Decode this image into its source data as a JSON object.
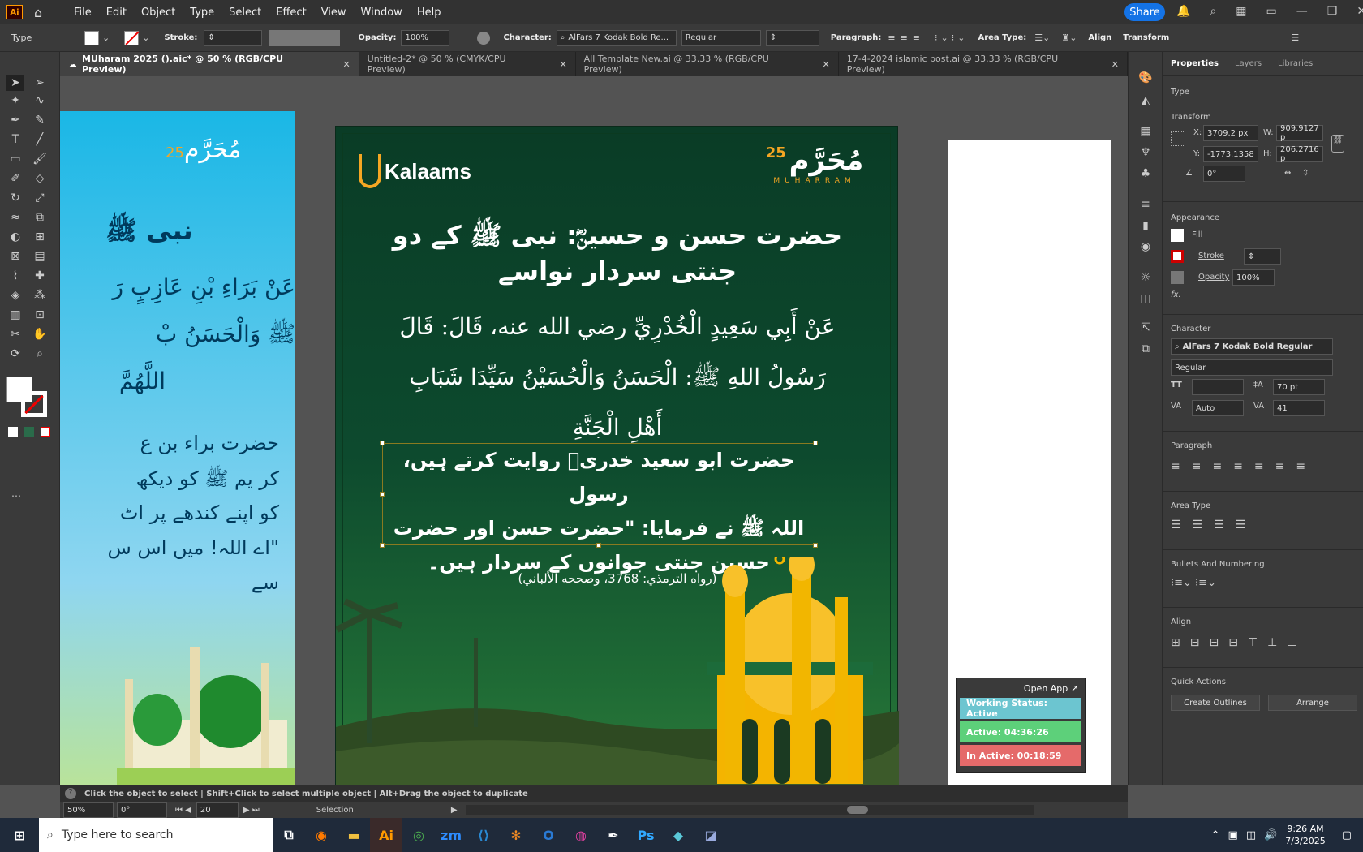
{
  "app": {
    "logo": "Ai",
    "menus": [
      "File",
      "Edit",
      "Object",
      "Type",
      "Select",
      "Effect",
      "View",
      "Window",
      "Help"
    ],
    "share": "Share"
  },
  "control": {
    "type_label": "Type",
    "stroke_label": "Stroke:",
    "opacity_label": "Opacity:",
    "opacity_value": "100%",
    "character_label": "Character:",
    "font_name": "AlFars 7 Kodak Bold Re...",
    "font_style": "Regular",
    "paragraph_label": "Paragraph:",
    "area_type_label": "Area Type:",
    "align_label": "Align",
    "transform_label": "Transform"
  },
  "tabs": [
    {
      "label": "MUharam 2025 ().aic* @ 50 % (RGB/CPU Preview)"
    },
    {
      "label": "Untitled-2* @ 50 % (CMYK/CPU Preview)"
    },
    {
      "label": "All Template New.ai @ 33.33 % (RGB/CPU Preview)"
    },
    {
      "label": "17-4-2024 islamic post.ai @ 33.33 % (RGB/CPU Preview)"
    }
  ],
  "artboard": {
    "brand": "Kalaams",
    "muharram_ar": "مُحَرَّم",
    "muharram_en": "MUHARRAM",
    "muharram_num": "25",
    "title_line1": "حضرت حسن و حسینؓ: نبی ﷺ کے دو",
    "title_line2": "جنتی سردار نواسے",
    "arabic_line1": "عَنْ أَبِي سَعِيدٍ الْخُدْرِيِّ رضي الله عنه، قَالَ: قَالَ",
    "arabic_line2": "رَسُولُ اللهِ ﷺ: الْحَسَنُ وَالْحُسَيْنُ سَيِّدَا شَبَابِ",
    "arabic_line3": "أَهْلِ الْجَنَّةِ",
    "urdu_line1": "حضرت ابو سعید خدریؓ روایت کرتے ہیں، رسول",
    "urdu_line2": "اللہ ﷺ نے فرمایا: \"حضرت حسن اور حضرت",
    "urdu_line3": "حسین جنتی جوانوں کے سردار ہیں۔",
    "reference": "(رواه الترمذي: 3768، وصححه الألباني)"
  },
  "left_artboard": {
    "line1": "نبی ﷺ",
    "line2": "عَنْ بَرَاءِ بْنِ عَازِبٍ رَ",
    "line3": "ﷺ وَالْحَسَنُ بْ",
    "line4": "اللَّهُمَّ",
    "u1": "حضرت براء بن ع",
    "u2": "کر یم ﷺ کو دیکھ",
    "u3": "کو اپنے کندھے پر اٹ",
    "u4": "\"اے اللہ! میں اس س",
    "u5": "سے"
  },
  "panel": {
    "tabs": [
      "Properties",
      "Layers",
      "Libraries"
    ],
    "type": "Type",
    "transform": "Transform",
    "x": "3709.2 px",
    "y": "-1773.1358",
    "w": "909.9127 p",
    "h": "206.2716 p",
    "angle": "0°",
    "appearance": "Appearance",
    "fill": "Fill",
    "stroke": "Stroke",
    "opacity": "Opacity",
    "opacity_value": "100%",
    "fx": "fx.",
    "character": "Character",
    "font": "AlFars 7 Kodak Bold Regular",
    "style": "Regular",
    "size": "",
    "leading": "70 pt",
    "kerning": "Auto",
    "tracking": "41",
    "paragraph": "Paragraph",
    "area_type": "Area Type",
    "bullets": "Bullets And Numbering",
    "align": "Align",
    "quick_actions": "Quick Actions",
    "create_outlines": "Create Outlines",
    "arrange": "Arrange"
  },
  "widget": {
    "open_app": "Open App ↗",
    "working": "Working Status: Active",
    "active": "Active: 04:36:26",
    "inactive": "In Active: 00:18:59",
    "colors": {
      "working": "#6cc5d0",
      "active": "#5dd07a",
      "inactive": "#e56a6a"
    }
  },
  "status": {
    "hint": "Click the object to select  |  Shift+Click to select multiple object  |  Alt+Drag the object to duplicate",
    "zoom": "50%",
    "rotate": "0°",
    "artboard": "20",
    "tool": "Selection"
  },
  "taskbar": {
    "search": "Type here to search",
    "time": "9:26 AM",
    "date": "7/3/2025"
  }
}
